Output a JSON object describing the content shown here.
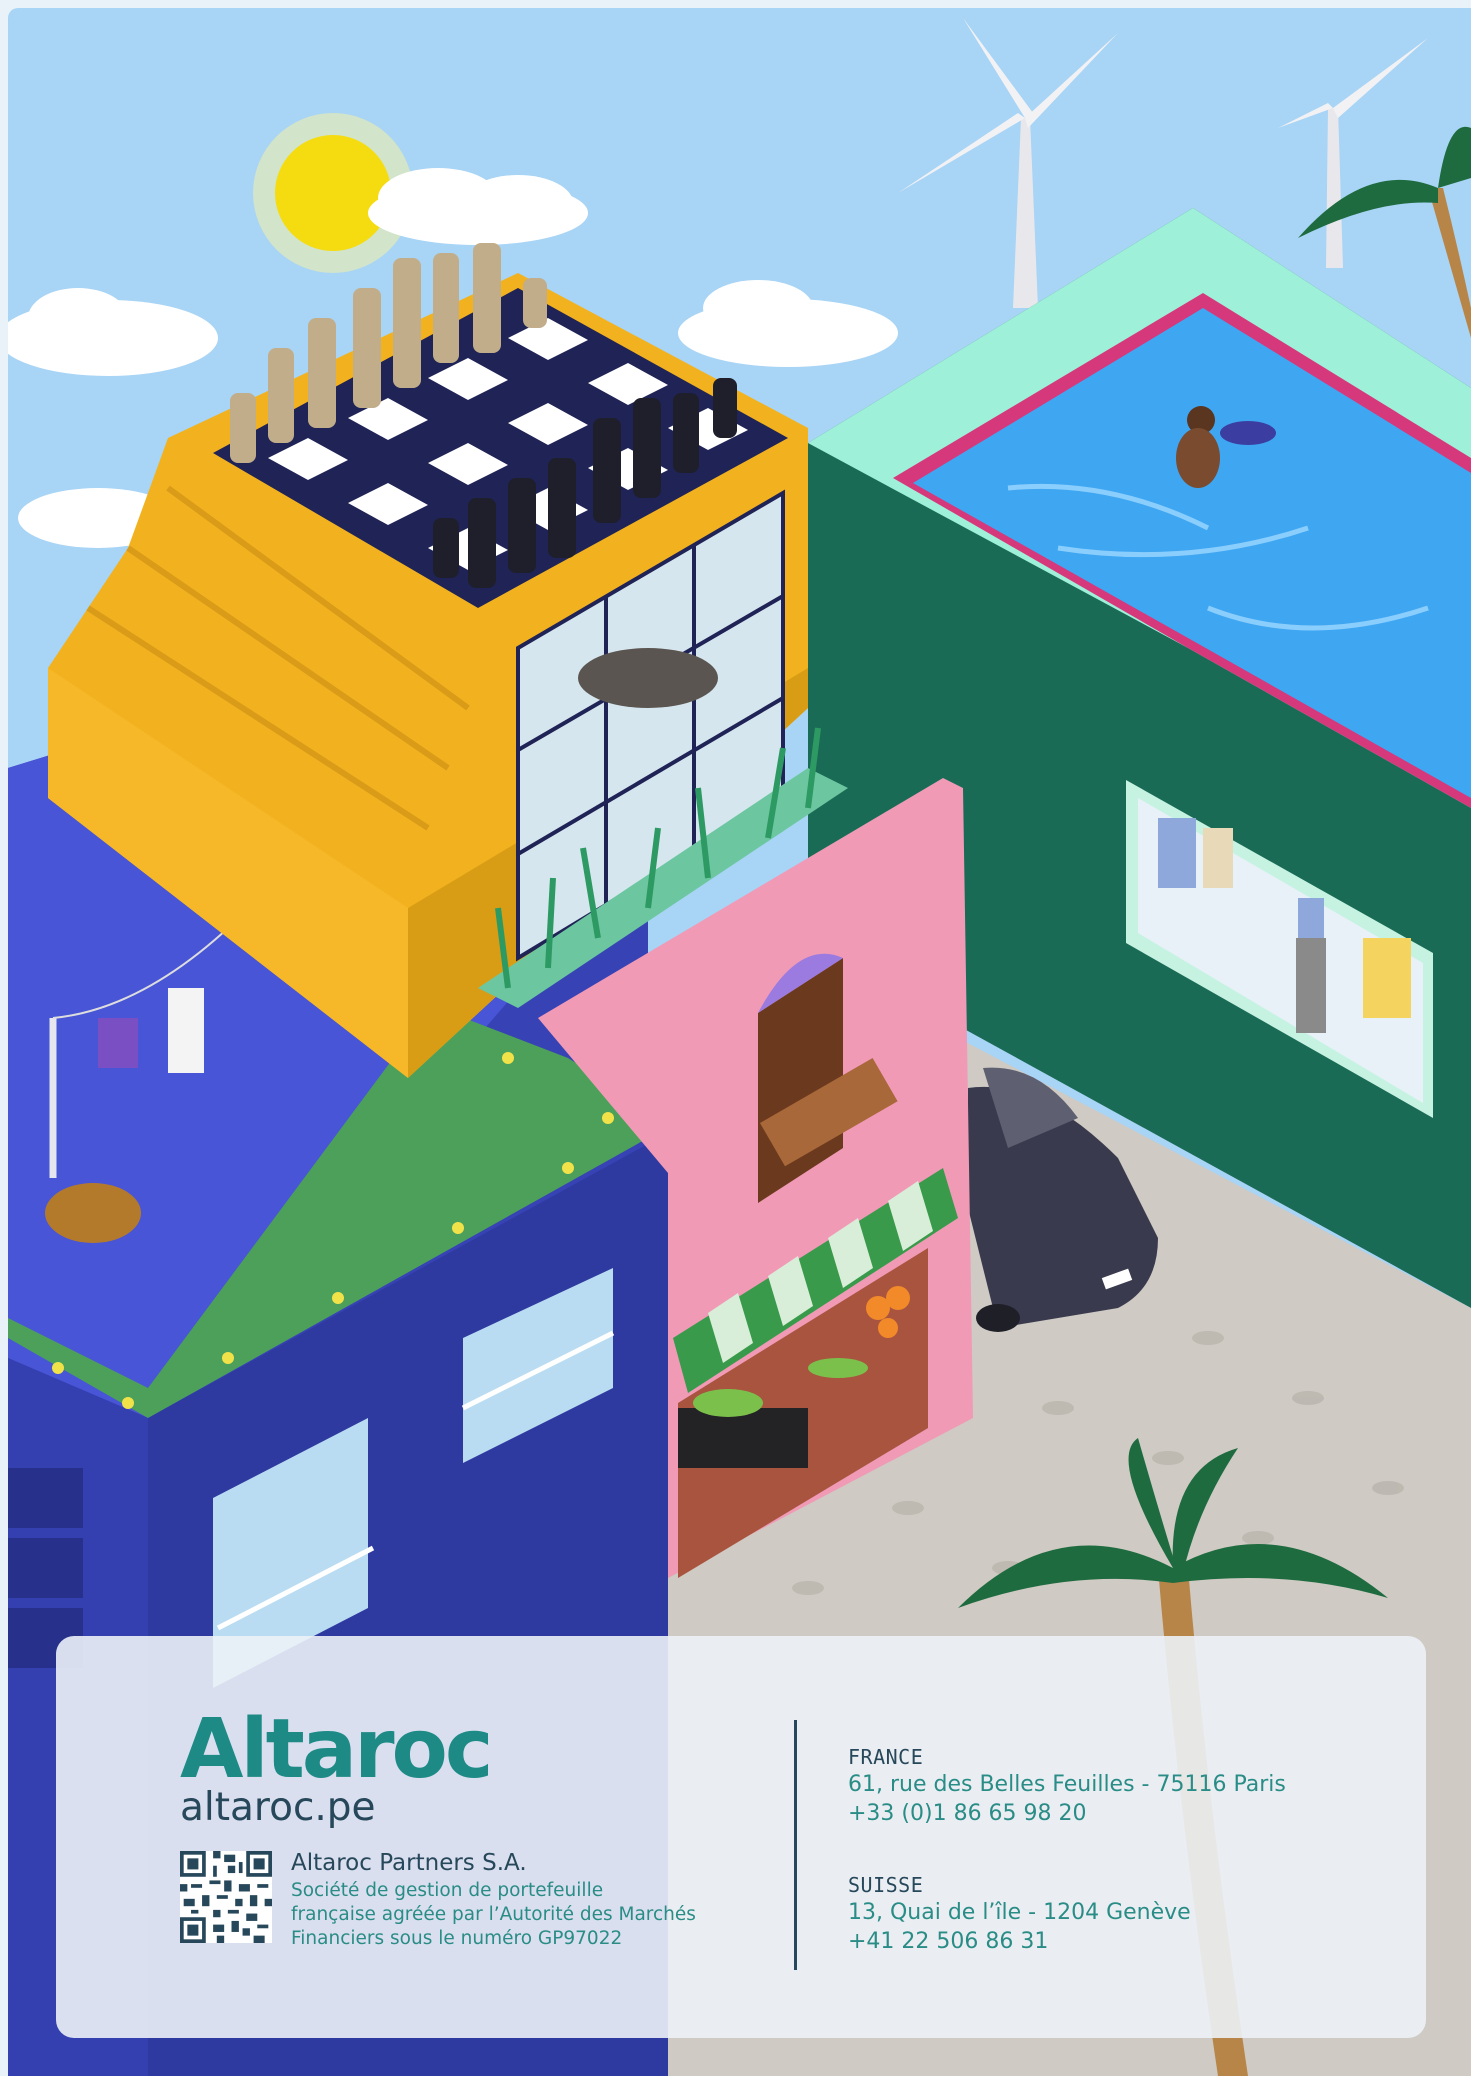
{
  "brand": {
    "logo_text": "Altaroc",
    "website": "altaroc.pe",
    "colors": {
      "teal": "#1e8a86",
      "navy": "#27475a"
    }
  },
  "company": {
    "name": "Altaroc Partners S.A.",
    "description_lines": [
      "Société de gestion de portefeuille",
      "française agréée par l’Autorité des Marchés",
      "Financiers sous le numéro GP97022"
    ]
  },
  "offices": [
    {
      "country": "FRANCE",
      "address": "61, rue des Belles Feuilles - 75116 Paris",
      "phone": "+33 (0)1 86 65 98 20"
    },
    {
      "country": "SUISSE",
      "address": "13, Quai de l’île - 1204 Genève",
      "phone": "+41 22 506 86 31"
    }
  ],
  "icons": {
    "qr": "qr-code-icon"
  }
}
